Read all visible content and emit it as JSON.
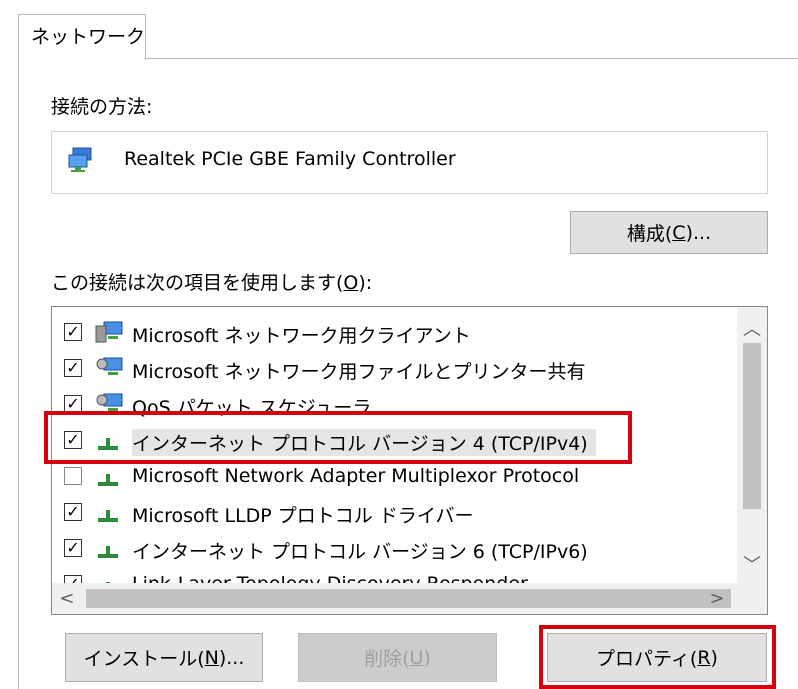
{
  "tab": {
    "label": "ネットワーク"
  },
  "connect_using": {
    "label": "接続の方法:"
  },
  "adapter": {
    "name": "Realtek PCIe GBE Family Controller"
  },
  "configure_button": {
    "text": "構成(",
    "key": "C",
    "suffix": ")..."
  },
  "items_label": {
    "text": "この接続は次の項目を使用します(",
    "key": "O",
    "suffix": "):"
  },
  "items": [
    {
      "label": "Microsoft ネットワーク用クライアント",
      "checked": true,
      "icon": "network-client-icon"
    },
    {
      "label": "Microsoft ネットワーク用ファイルとプリンター共有",
      "checked": true,
      "icon": "network-service-icon"
    },
    {
      "label": "QoS パケット スケジューラ",
      "checked": true,
      "icon": "network-service-icon"
    },
    {
      "label": "インターネット プロトコル バージョン 4 (TCP/IPv4)",
      "checked": true,
      "icon": "protocol-icon",
      "selected": true
    },
    {
      "label": "Microsoft Network Adapter Multiplexor Protocol",
      "checked": false,
      "icon": "protocol-icon"
    },
    {
      "label": "Microsoft LLDP プロトコル ドライバー",
      "checked": true,
      "icon": "protocol-icon"
    },
    {
      "label": "インターネット プロトコル バージョン 6 (TCP/IPv6)",
      "checked": true,
      "icon": "protocol-icon"
    },
    {
      "label": "Link-Layer Topology Discovery Responder",
      "checked": true,
      "icon": "protocol-icon"
    }
  ],
  "install_button": {
    "text": "インストール(",
    "key": "N",
    "suffix": ")..."
  },
  "uninstall_button": {
    "text": "削除(",
    "key": "U",
    "suffix": ")",
    "disabled": true
  },
  "properties_button": {
    "text": "プロパティ(",
    "key": "R",
    "suffix": ")"
  },
  "colors": {
    "highlight": "#d6000f",
    "button": "#e1e1e1",
    "selection": "#e5e5e5"
  }
}
